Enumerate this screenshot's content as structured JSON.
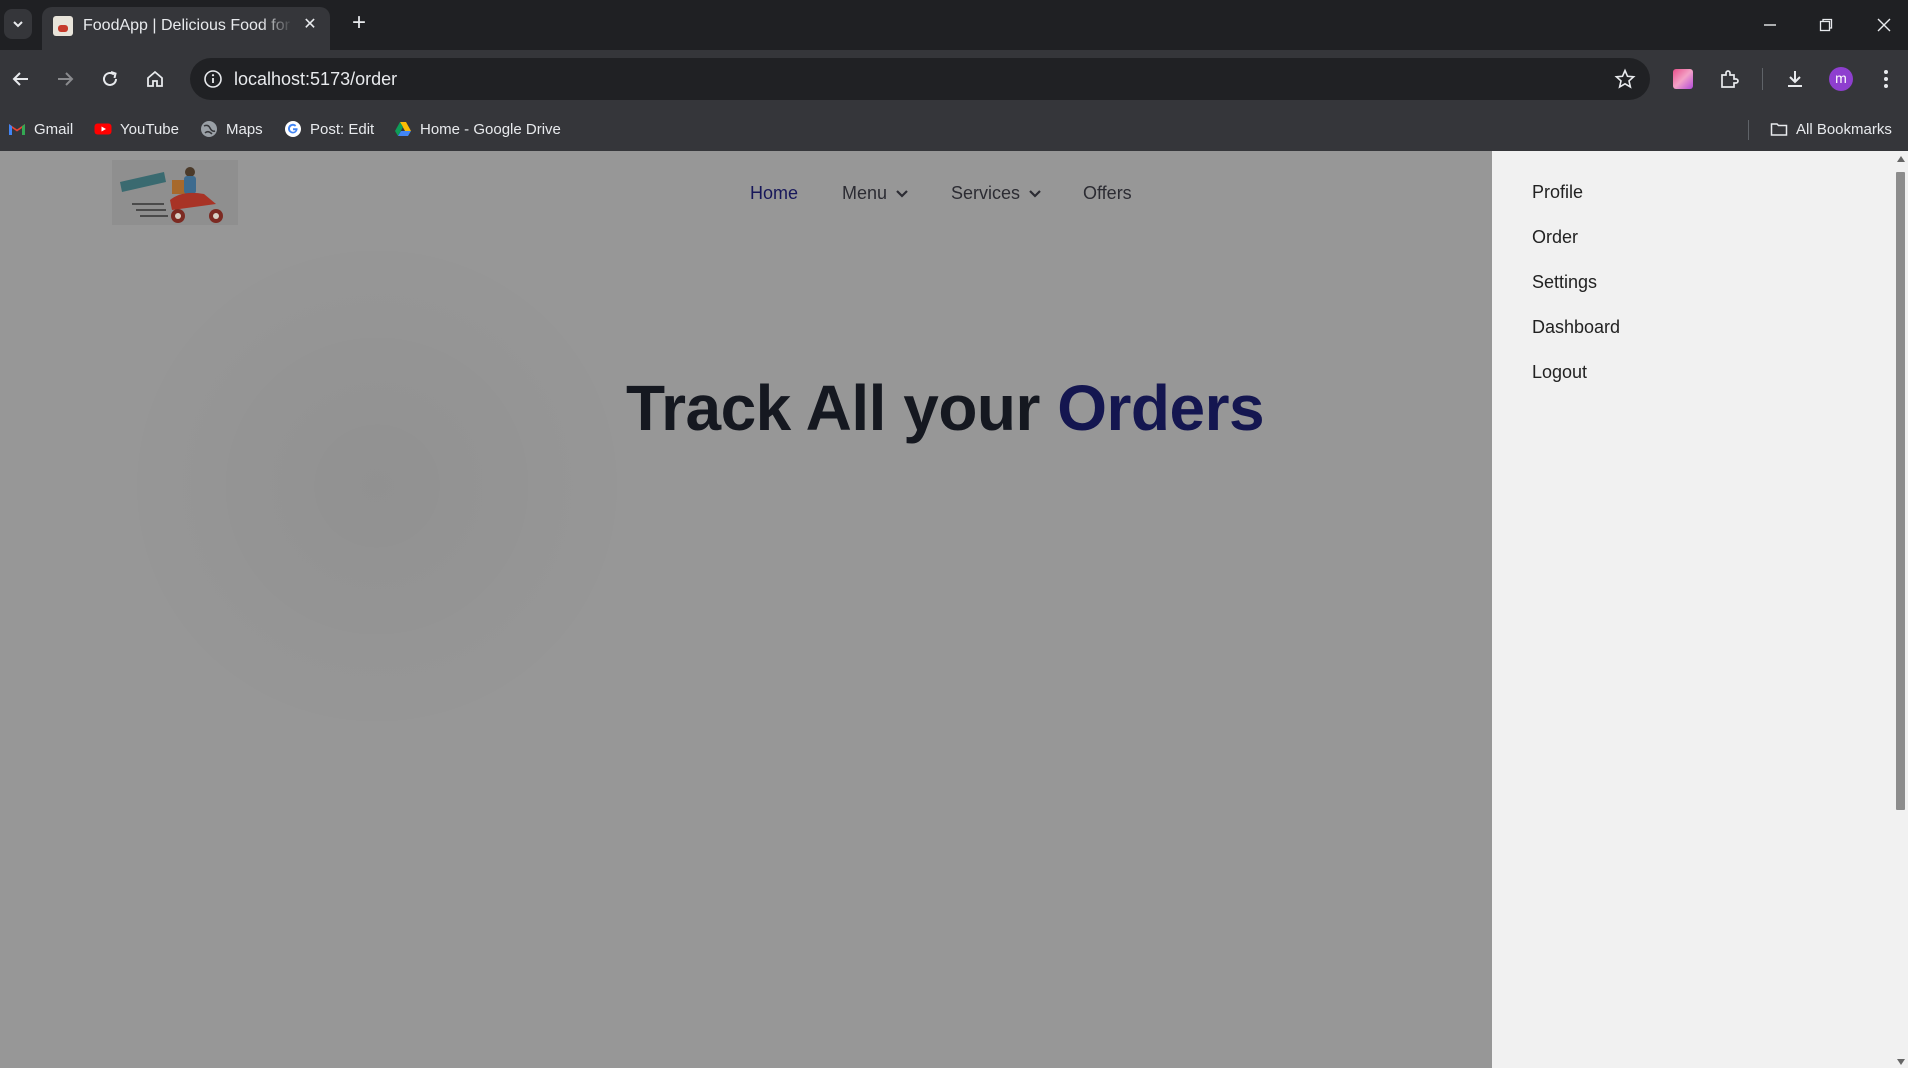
{
  "browser": {
    "tab": {
      "title": "FoodApp | Delicious Food for All",
      "close": "✕"
    },
    "new_tab": "+",
    "url": "localhost:5173/order",
    "avatar_letter": "m",
    "bookmarks": [
      {
        "label": "Gmail",
        "icon": "gmail-icon"
      },
      {
        "label": "YouTube",
        "icon": "youtube-icon"
      },
      {
        "label": "Maps",
        "icon": "maps-icon"
      },
      {
        "label": "Post: Edit",
        "icon": "google-icon"
      },
      {
        "label": "Home - Google Drive",
        "icon": "drive-icon"
      }
    ],
    "all_bookmarks": "All Bookmarks"
  },
  "site": {
    "nav": {
      "home": "Home",
      "menu": "Menu",
      "services": "Services",
      "offers": "Offers"
    },
    "hero": {
      "title_main": "Track All your ",
      "title_accent": "Orders"
    },
    "profile_menu": {
      "items": [
        "Profile",
        "Order",
        "Settings",
        "Dashboard",
        "Logout"
      ]
    }
  },
  "colors": {
    "chrome_bg": "#1f2023",
    "toolbar_bg": "#35363a",
    "page_overlay": "#979797",
    "panel_bg": "#f1f1f1",
    "accent": "#141650"
  }
}
